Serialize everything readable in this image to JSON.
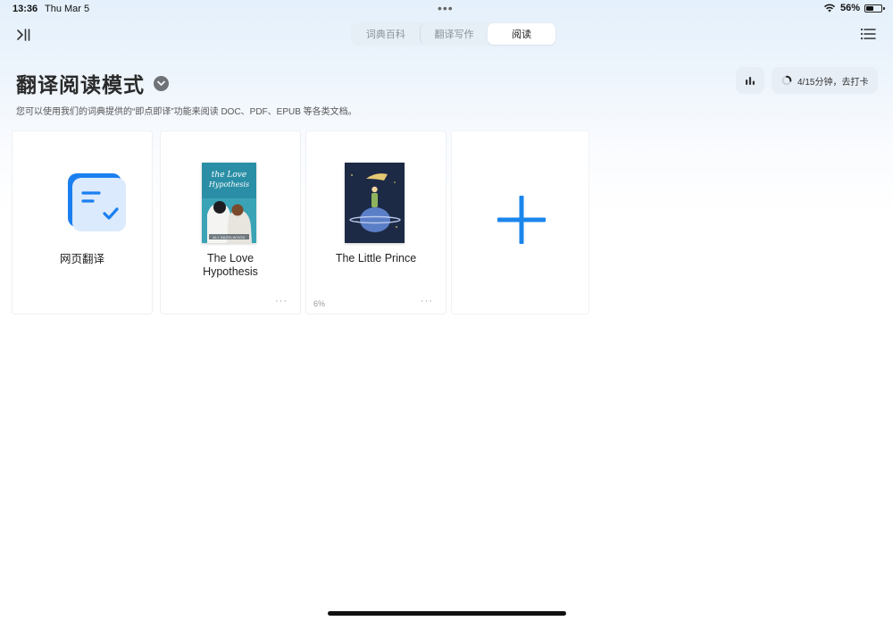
{
  "status_bar": {
    "time": "13:36",
    "date": "Thu Mar 5",
    "battery_percent": "56%",
    "battery_level": 0.56
  },
  "tabs": [
    {
      "label": "词典百科",
      "active": false
    },
    {
      "label": "翻译写作",
      "active": false
    },
    {
      "label": "阅读",
      "active": true
    }
  ],
  "header": {
    "title": "翻译阅读模式",
    "subtitle": "您可以使用我们的词典提供的“即点即译”功能来阅读 DOC、PDF、EPUB 等各类文档。",
    "checkin_label": "4/15分钟，去打卡",
    "checkin_progress_minutes": 4,
    "checkin_goal_minutes": 15
  },
  "cards": [
    {
      "label": "网页翻译",
      "icon": "web-translate-icon"
    },
    {
      "label": "The Love Hypothesis",
      "more": "···",
      "cover_title_line1": "the Love",
      "cover_title_line2": "Hypothesis",
      "cover_author": "ALI HAZELWOOD"
    },
    {
      "label": "The Little Prince",
      "progress": "6%",
      "more": "···"
    },
    {
      "icon": "plus-icon"
    }
  ],
  "colors": {
    "accent": "#1a7ff0",
    "plus": "#1b86ec",
    "love_cover": "#2a8fa6",
    "prince_cover": "#1d2a45"
  }
}
